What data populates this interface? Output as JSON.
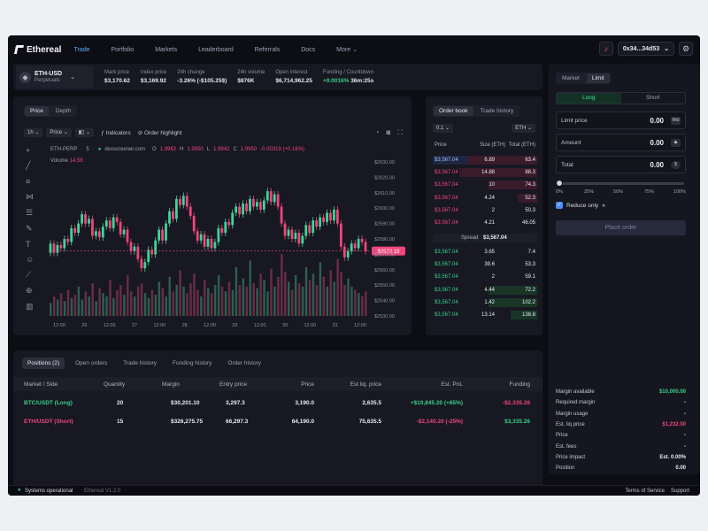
{
  "app": {
    "logo": "Ethereal",
    "nav": [
      "Trade",
      "Portfolio",
      "Markets",
      "Leaderboard",
      "Referrals",
      "Docs",
      "More"
    ],
    "account": "0x34...34d53",
    "icons": {
      "notifications": "bell-icon",
      "settings": "gear-icon",
      "more": "chevron-down-icon"
    }
  },
  "market": {
    "pair": "ETH-USD",
    "type": "Perpetuals",
    "stats": [
      {
        "label": "Mark price",
        "value": "$3,170.62",
        "tone": "default"
      },
      {
        "label": "Index price",
        "value": "$3,169.92",
        "tone": "default"
      },
      {
        "label": "24h change",
        "value": "-3.26% (-$105.25$)",
        "tone": "default"
      },
      {
        "label": "24h volume",
        "value": "$876K",
        "tone": "default"
      },
      {
        "label": "Open interest",
        "value": "$6,714,962.25",
        "tone": "default"
      },
      {
        "label": "Funding / Countdown",
        "value": "+0.0016%",
        "value2": "36m:25s",
        "tone": "green"
      }
    ]
  },
  "chart": {
    "tabs": [
      "Price",
      "Depth"
    ],
    "active_tab": "Price",
    "toolbar": {
      "interval": "1h",
      "price_type": "Price",
      "indicators": "Indicators",
      "highlight": "Order highlight"
    },
    "symbol": "ETH-PERP",
    "symbol_sep": "·",
    "interval_text": "5",
    "source": "dexscreener.com",
    "ohlc": {
      "o": "1.9982",
      "h": "1.9950",
      "l": "1.9942",
      "c": "1.9950",
      "change": "-0.00319 (+0.16%)"
    },
    "volume_label": "Volume",
    "volume_value": "14.58",
    "price_tag": "$2572.19"
  },
  "chart_data": {
    "type": "candlestick",
    "y_ticks": [
      "$2630.00",
      "$2620.00",
      "$2610.00",
      "$2600.00",
      "$2590.00",
      "$2580.00",
      "$2570.00",
      "$2560.00",
      "$2550.00",
      "$2540.00",
      "$2530.00"
    ],
    "x_ticks": [
      "12:00",
      "26",
      "12:00",
      "27",
      "12:00",
      "28",
      "12:00",
      "29",
      "12:00",
      "30",
      "12:00",
      "31",
      "12:00"
    ],
    "ylim": [
      2530,
      2630
    ],
    "current_price": 2572.19,
    "candles": [
      [
        2571,
        2577
      ],
      [
        2577,
        2571
      ],
      [
        2571,
        2576
      ],
      [
        2576,
        2574
      ],
      [
        2574,
        2580
      ],
      [
        2580,
        2578
      ],
      [
        2578,
        2587
      ],
      [
        2587,
        2584
      ],
      [
        2584,
        2590
      ],
      [
        2590,
        2596
      ],
      [
        2596,
        2590
      ],
      [
        2590,
        2593
      ],
      [
        2593,
        2582
      ],
      [
        2582,
        2585
      ],
      [
        2585,
        2581
      ],
      [
        2581,
        2588
      ],
      [
        2588,
        2592
      ],
      [
        2592,
        2587
      ],
      [
        2587,
        2594
      ],
      [
        2594,
        2591
      ],
      [
        2591,
        2583
      ],
      [
        2583,
        2586
      ],
      [
        2586,
        2578
      ],
      [
        2578,
        2572
      ],
      [
        2572,
        2575
      ],
      [
        2575,
        2567
      ],
      [
        2567,
        2561
      ],
      [
        2561,
        2565
      ],
      [
        2565,
        2573
      ],
      [
        2573,
        2570
      ],
      [
        2570,
        2579
      ],
      [
        2579,
        2586
      ],
      [
        2586,
        2579
      ],
      [
        2579,
        2590
      ],
      [
        2590,
        2598
      ],
      [
        2598,
        2593
      ],
      [
        2593,
        2606
      ],
      [
        2606,
        2602
      ],
      [
        2602,
        2608
      ],
      [
        2608,
        2601
      ],
      [
        2601,
        2595
      ],
      [
        2595,
        2585
      ],
      [
        2585,
        2579
      ],
      [
        2579,
        2583
      ],
      [
        2583,
        2575
      ],
      [
        2575,
        2580
      ],
      [
        2580,
        2574
      ],
      [
        2574,
        2578
      ],
      [
        2578,
        2587
      ],
      [
        2587,
        2584
      ],
      [
        2584,
        2591
      ],
      [
        2591,
        2589
      ],
      [
        2589,
        2597
      ],
      [
        2597,
        2601
      ],
      [
        2601,
        2596
      ],
      [
        2596,
        2603
      ],
      [
        2603,
        2598
      ],
      [
        2598,
        2606
      ],
      [
        2606,
        2601
      ],
      [
        2601,
        2604
      ],
      [
        2604,
        2599
      ],
      [
        2599,
        2605
      ],
      [
        2605,
        2611
      ],
      [
        2611,
        2604
      ],
      [
        2604,
        2609
      ],
      [
        2609,
        2601
      ],
      [
        2601,
        2590
      ],
      [
        2590,
        2582
      ],
      [
        2582,
        2586
      ],
      [
        2586,
        2580
      ],
      [
        2580,
        2584
      ],
      [
        2584,
        2577
      ],
      [
        2577,
        2582
      ],
      [
        2582,
        2589
      ],
      [
        2589,
        2584
      ],
      [
        2584,
        2592
      ],
      [
        2592,
        2588
      ],
      [
        2588,
        2594
      ],
      [
        2594,
        2591
      ],
      [
        2591,
        2597
      ],
      [
        2597,
        2592
      ],
      [
        2592,
        2599
      ],
      [
        2599,
        2590
      ],
      [
        2590,
        2575
      ],
      [
        2575,
        2568
      ],
      [
        2568,
        2572
      ],
      [
        2572,
        2577
      ],
      [
        2577,
        2574
      ],
      [
        2574,
        2580
      ],
      [
        2580,
        2578
      ],
      [
        2578,
        2572
      ]
    ],
    "volume": [
      8,
      12,
      10,
      14,
      9,
      16,
      11,
      13,
      18,
      10,
      15,
      12,
      20,
      9,
      17,
      14,
      12,
      22,
      11,
      16,
      19,
      13,
      25,
      15,
      12,
      18,
      20,
      14,
      11,
      16,
      13,
      21,
      17,
      12,
      24,
      15,
      19,
      28,
      18,
      14,
      20,
      26,
      16,
      12,
      22,
      17,
      14,
      19,
      25,
      18,
      15,
      21,
      16,
      30,
      19,
      23,
      18,
      34,
      20,
      17,
      26,
      22,
      15,
      29,
      18,
      24,
      38,
      27,
      21,
      16,
      25,
      20,
      18,
      30,
      22,
      26,
      19,
      33,
      24,
      18,
      28,
      21,
      35,
      27,
      19,
      23,
      18,
      16,
      14,
      12,
      15
    ]
  },
  "orderbook": {
    "tabs": [
      "Order book",
      "Trade history"
    ],
    "active_tab": "Order book",
    "step": "0.1",
    "unit": "ETH",
    "headers": [
      "Price",
      "Size (ETH)",
      "Total (ETH)"
    ],
    "spread_label": "Spread",
    "spread_value": "$3,567.04",
    "asks": [
      {
        "price": "$3,567.04",
        "size": "6.89",
        "total": "63.4",
        "depth": 0.9,
        "highlight": true
      },
      {
        "price": "$3,567.04",
        "size": "14.88",
        "total": "88.3",
        "depth": 1.0,
        "highlight": false
      },
      {
        "price": "$3,567.04",
        "size": "10",
        "total": "74.3",
        "depth": 0.62,
        "highlight": false
      },
      {
        "price": "$3,567.04",
        "size": "4.24",
        "total": "52.3",
        "depth": 0.25,
        "highlight": false
      },
      {
        "price": "$3,567.04",
        "size": "2",
        "total": "50.3",
        "depth": 0.0,
        "highlight": false
      },
      {
        "price": "$3,567.04",
        "size": "4.21",
        "total": "46.05",
        "depth": 0.0,
        "highlight": false
      }
    ],
    "bids": [
      {
        "price": "$3,567.04",
        "size": "3.65",
        "total": "7.4",
        "depth": 0.0
      },
      {
        "price": "$3,567.04",
        "size": "39.6",
        "total": "53.3",
        "depth": 0.0
      },
      {
        "price": "$3,567.04",
        "size": "2",
        "total": "59.1",
        "depth": 0.0
      },
      {
        "price": "$3,567.04",
        "size": "4.44",
        "total": "72.2",
        "depth": 0.62
      },
      {
        "price": "$3,567.04",
        "size": "1.42",
        "total": "102.2",
        "depth": 0.62
      },
      {
        "price": "$3,567.04",
        "size": "13.14",
        "total": "138.8",
        "depth": 0.34
      }
    ]
  },
  "positions": {
    "tabs": [
      "Positions (2)",
      "Open orders",
      "Trade history",
      "Funding history",
      "Order history"
    ],
    "active_tab": "Positions (2)",
    "headers": [
      "Market / Side",
      "Quantity",
      "Margin",
      "Entry price",
      "Price",
      "Est liq. price",
      "Est. PnL",
      "Funding"
    ],
    "rows": [
      {
        "market": "BTC/USDT (Long)",
        "side": "long",
        "quantity": "20",
        "margin": "$30,201.10",
        "entry": "3,297.3",
        "price": "3,190.0",
        "liq": "2,635.5",
        "pnl": "+$10,845.20 (+65%)",
        "funding": "-$2,335.26"
      },
      {
        "market": "ETH/USDT (Short)",
        "side": "short",
        "quantity": "15",
        "margin": "$326,275.75",
        "entry": "66,297.3",
        "price": "64,190.0",
        "liq": "75,635.5",
        "pnl": "-$2,140.20 (-25%)",
        "funding": "$3,335.26"
      }
    ]
  },
  "order_form": {
    "order_types": [
      "Market",
      "Limit"
    ],
    "active_type": "Limit",
    "sides": [
      "Long",
      "Short"
    ],
    "active_side": "Long",
    "limit_price": {
      "label": "Limit price",
      "value": "0.00",
      "unit": "Mid"
    },
    "amount": {
      "label": "Amount",
      "value": "0.00",
      "unit": "ETH"
    },
    "total": {
      "label": "Total",
      "value": "0.00",
      "unit": "USD"
    },
    "slider_marks": [
      "0%",
      "25%",
      "50%",
      "75%",
      "100%"
    ],
    "slider_value": 0,
    "reduce_only": "Reduce only",
    "place_order": "Place order",
    "summary": [
      {
        "label": "Margin available",
        "value": "$10,000.00",
        "tone": "green"
      },
      {
        "label": "Required margin",
        "value": "-",
        "tone": "default"
      },
      {
        "label": "Margin usage",
        "value": "-",
        "tone": "default"
      },
      {
        "label": "Est. liq price",
        "value": "$1,232.00",
        "tone": "red"
      },
      {
        "label": "Price",
        "value": "-",
        "tone": "default"
      },
      {
        "label": "Est. fees",
        "value": "-",
        "tone": "default"
      },
      {
        "label": "Price impact",
        "value": "Est. 0.00%",
        "tone": "default"
      },
      {
        "label": "Position",
        "value": "0.00",
        "tone": "default"
      }
    ]
  },
  "footer": {
    "status": "Systems operational",
    "version": "Ethereal V1.2.0",
    "links": [
      "Terms of Service",
      "Support"
    ]
  },
  "colors": {
    "up": "#38d189",
    "down": "#f0467c",
    "accent": "#5aa9ff",
    "panel": "#171822"
  }
}
